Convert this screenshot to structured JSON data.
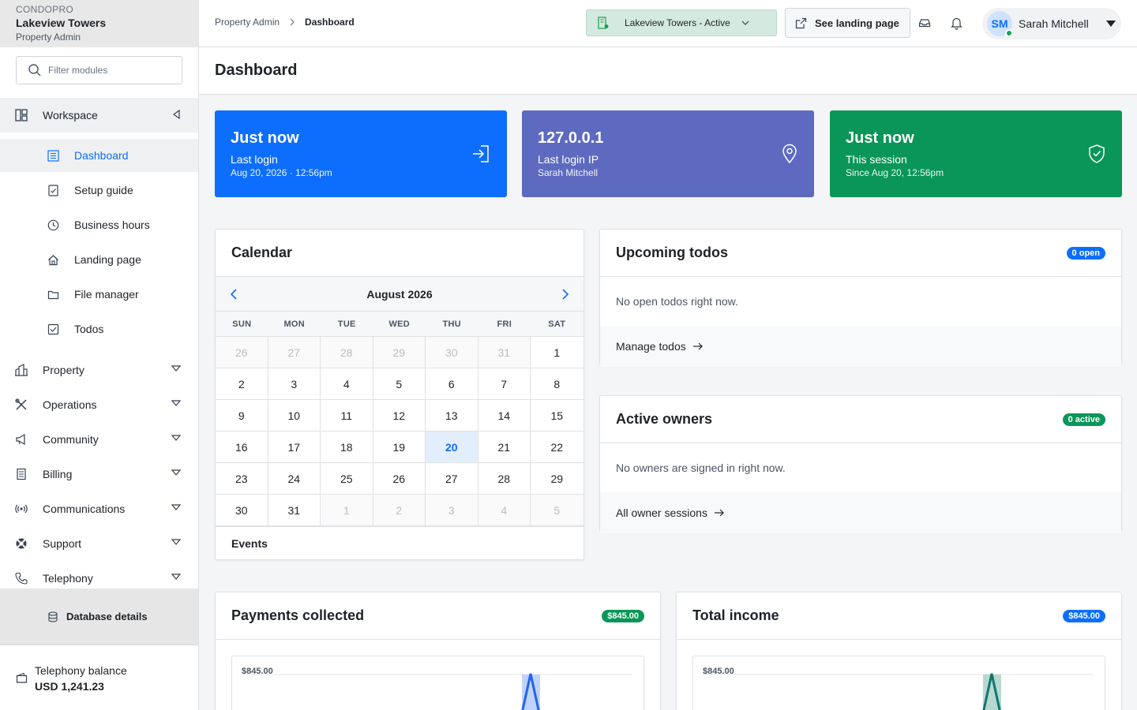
{
  "sidebar": {
    "org": "CONDOPRO",
    "property_name": "Lakeview Towers",
    "role": "Property Admin",
    "filter_placeholder": "Filter modules",
    "workspace_label": "Workspace",
    "workspace_items": [
      {
        "label": "Dashboard",
        "icon": "dashboard-icon",
        "active": true
      },
      {
        "label": "Setup guide",
        "icon": "checklist-icon"
      },
      {
        "label": "Business hours",
        "icon": "clock-icon"
      },
      {
        "label": "Landing page",
        "icon": "home-icon"
      },
      {
        "label": "File manager",
        "icon": "folder-icon"
      },
      {
        "label": "Todos",
        "icon": "checkbox-icon"
      }
    ],
    "groups": [
      {
        "label": "Property",
        "icon": "building-icon"
      },
      {
        "label": "Operations",
        "icon": "tools-icon"
      },
      {
        "label": "Community",
        "icon": "megaphone-icon"
      },
      {
        "label": "Billing",
        "icon": "receipt-icon"
      },
      {
        "label": "Communications",
        "icon": "broadcast-icon"
      },
      {
        "label": "Support",
        "icon": "lifebuoy-icon"
      },
      {
        "label": "Telephony",
        "icon": "phone-icon"
      }
    ],
    "database_details": "Database details",
    "telephony_balance_label": "Telephony balance",
    "telephony_balance_value": "USD 1,241.23"
  },
  "topbar": {
    "breadcrumb_root": "Property Admin",
    "breadcrumb_current": "Dashboard",
    "property_selector": "Lakeview Towers - Active",
    "landing_button": "See landing page",
    "user_initials": "SM",
    "user_name": "Sarah Mitchell"
  },
  "page_title": "Dashboard",
  "stats": [
    {
      "value": "Just now",
      "label": "Last login",
      "sub": "Aug 20, 2026 · 12:56pm",
      "color": "#0d6efd",
      "icon": "login-icon"
    },
    {
      "value": "127.0.0.1",
      "label": "Last login IP",
      "sub": "Sarah Mitchell",
      "color": "#5e6ac0",
      "icon": "location-pin-icon"
    },
    {
      "value": "Just now",
      "label": "This session",
      "sub": "Since Aug 20, 12:56pm",
      "color": "#0a9658",
      "icon": "shield-check-icon"
    }
  ],
  "calendar": {
    "title": "Calendar",
    "month": "August 2026",
    "weekdays": [
      "SUN",
      "MON",
      "TUE",
      "WED",
      "THU",
      "FRI",
      "SAT"
    ],
    "days": [
      {
        "d": "26",
        "o": true
      },
      {
        "d": "27",
        "o": true
      },
      {
        "d": "28",
        "o": true
      },
      {
        "d": "29",
        "o": true
      },
      {
        "d": "30",
        "o": true
      },
      {
        "d": "31",
        "o": true
      },
      {
        "d": "1"
      },
      {
        "d": "2"
      },
      {
        "d": "3"
      },
      {
        "d": "4"
      },
      {
        "d": "5"
      },
      {
        "d": "6"
      },
      {
        "d": "7"
      },
      {
        "d": "8"
      },
      {
        "d": "9"
      },
      {
        "d": "10"
      },
      {
        "d": "11"
      },
      {
        "d": "12"
      },
      {
        "d": "13"
      },
      {
        "d": "14"
      },
      {
        "d": "15"
      },
      {
        "d": "16"
      },
      {
        "d": "17"
      },
      {
        "d": "18"
      },
      {
        "d": "19"
      },
      {
        "d": "20",
        "today": true
      },
      {
        "d": "21"
      },
      {
        "d": "22"
      },
      {
        "d": "23"
      },
      {
        "d": "24"
      },
      {
        "d": "25"
      },
      {
        "d": "26"
      },
      {
        "d": "27"
      },
      {
        "d": "28"
      },
      {
        "d": "29"
      },
      {
        "d": "30"
      },
      {
        "d": "31"
      },
      {
        "d": "1",
        "o": true
      },
      {
        "d": "2",
        "o": true
      },
      {
        "d": "3",
        "o": true
      },
      {
        "d": "4",
        "o": true
      },
      {
        "d": "5",
        "o": true
      }
    ],
    "events_label": "Events"
  },
  "todos": {
    "title": "Upcoming todos",
    "badge": "0 open",
    "empty": "No open todos right now.",
    "link": "Manage todos"
  },
  "owners": {
    "title": "Active owners",
    "badge": "0 active",
    "empty": "No owners are signed in right now.",
    "link": "All owner sessions"
  },
  "payments": {
    "title": "Payments collected",
    "badge": "$845.00",
    "chart_label": "$845.00",
    "color": "#2563eb"
  },
  "income": {
    "title": "Total income",
    "badge": "$845.00",
    "chart_label": "$845.00",
    "color": "#0f766e"
  }
}
